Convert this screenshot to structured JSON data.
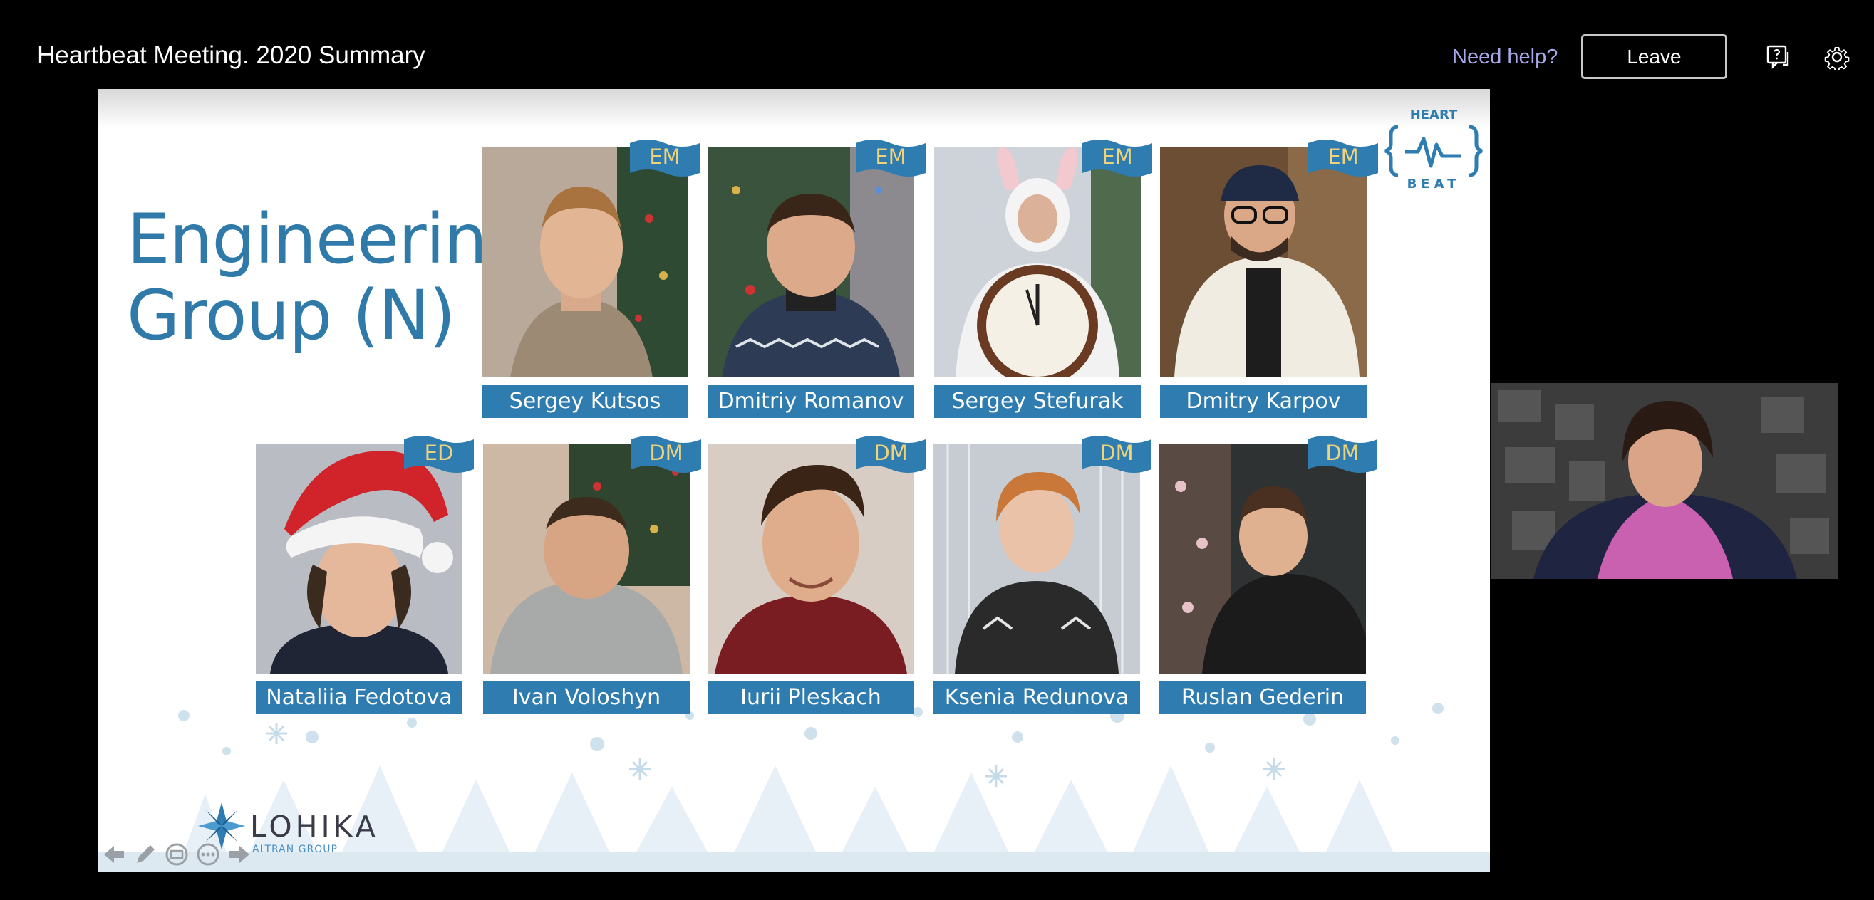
{
  "meeting": {
    "title": "Heartbeat Meeting. 2020 Summary",
    "help_link": "Need help?",
    "leave_label": "Leave",
    "icons": [
      "chat-question-icon",
      "gear-icon"
    ]
  },
  "slide": {
    "title_line1": "Engineering",
    "title_line2": "Group (N)",
    "logo_top": "HEART",
    "logo_bottom": "BEAT",
    "company_name": "LOHIKA",
    "company_sub": "ALTRAN GROUP",
    "accent_color": "#2e7cb0",
    "people": [
      {
        "name": "Sergey Kutsos",
        "role": "EM"
      },
      {
        "name": "Dmitriy Romanov",
        "role": "EM"
      },
      {
        "name": "Sergey Stefurak",
        "role": "EM"
      },
      {
        "name": "Dmitry Karpov",
        "role": "EM"
      },
      {
        "name": "Nataliia Fedotova",
        "role": "ED"
      },
      {
        "name": "Ivan Voloshyn",
        "role": "DM"
      },
      {
        "name": "Iurii Pleskach",
        "role": "DM"
      },
      {
        "name": "Ksenia Redunova",
        "role": "DM"
      },
      {
        "name": "Ruslan Gederin",
        "role": "DM"
      }
    ],
    "controls": [
      "arrow-left-icon",
      "pen-icon",
      "subtitles-icon",
      "more-icon",
      "arrow-right-icon"
    ]
  }
}
